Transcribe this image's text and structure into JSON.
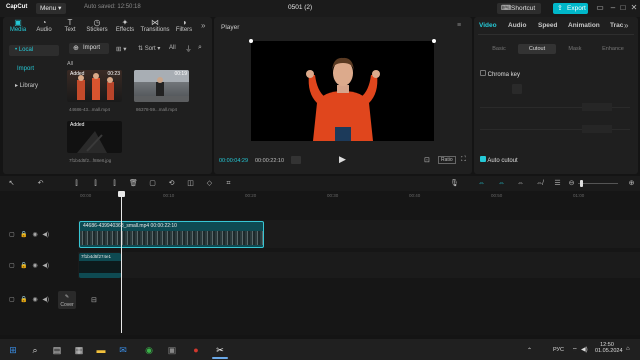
{
  "topbar": {
    "logo": "CapCut",
    "menu_label": "Menu",
    "autosave": "Auto saved: 12:50:18",
    "project_title": "0501 (2)",
    "shortcut_label": "Shortcut",
    "export_label": "Export"
  },
  "media_tabs": [
    {
      "label": "Media",
      "icon": "media-icon",
      "active": true
    },
    {
      "label": "Audio",
      "icon": "audio-icon"
    },
    {
      "label": "Text",
      "icon": "text-icon"
    },
    {
      "label": "Stickers",
      "icon": "stickers-icon"
    },
    {
      "label": "Effects",
      "icon": "effects-icon"
    },
    {
      "label": "Transitions",
      "icon": "transitions-icon"
    },
    {
      "label": "Filters",
      "icon": "filters-icon"
    }
  ],
  "media_side": {
    "local": "• Local",
    "import": "Import",
    "library": "▸ Library"
  },
  "media_toolbar": {
    "import_label": "Import",
    "sort_label": "Sort",
    "all_label": "All",
    "filter_all": "All"
  },
  "media_items": [
    {
      "badge": "Added",
      "duration": "00:23",
      "name": "44686-43...mall.mp4"
    },
    {
      "badge": "",
      "duration": "00:19",
      "name": "86378-59...mall.mp4"
    },
    {
      "badge": "Added",
      "duration": "",
      "name": "7f1b4d5f2...f88e8.jpg"
    }
  ],
  "player": {
    "title": "Player",
    "current_time": "00:00:04:29",
    "total_time": "00:00:22:10",
    "ratio_label": "Ratio"
  },
  "inspector": {
    "tabs": [
      "Video",
      "Audio",
      "Speed",
      "Animation",
      "Trac"
    ],
    "subtabs": [
      "Basic",
      "Cutout",
      "Mask",
      "Enhance"
    ],
    "chroma_key": "Chroma key",
    "auto_cutout": "Auto cutout"
  },
  "timeline": {
    "ticks": [
      "00:00",
      "00:10",
      "00:20",
      "00:30",
      "00:40",
      "00:50",
      "01:00"
    ],
    "clip_main": "44686-439940368_small.mp4  00:00:22:10",
    "clip_image": "7f1b4d5f274e1",
    "cover_label": "Cover"
  },
  "taskbar": {
    "time": "12:50",
    "date": "01.05.2024",
    "lang": "РУС"
  },
  "colors": {
    "accent": "#00b7c9",
    "clip": "#0e4a52",
    "clip_border": "#38c6d4"
  }
}
